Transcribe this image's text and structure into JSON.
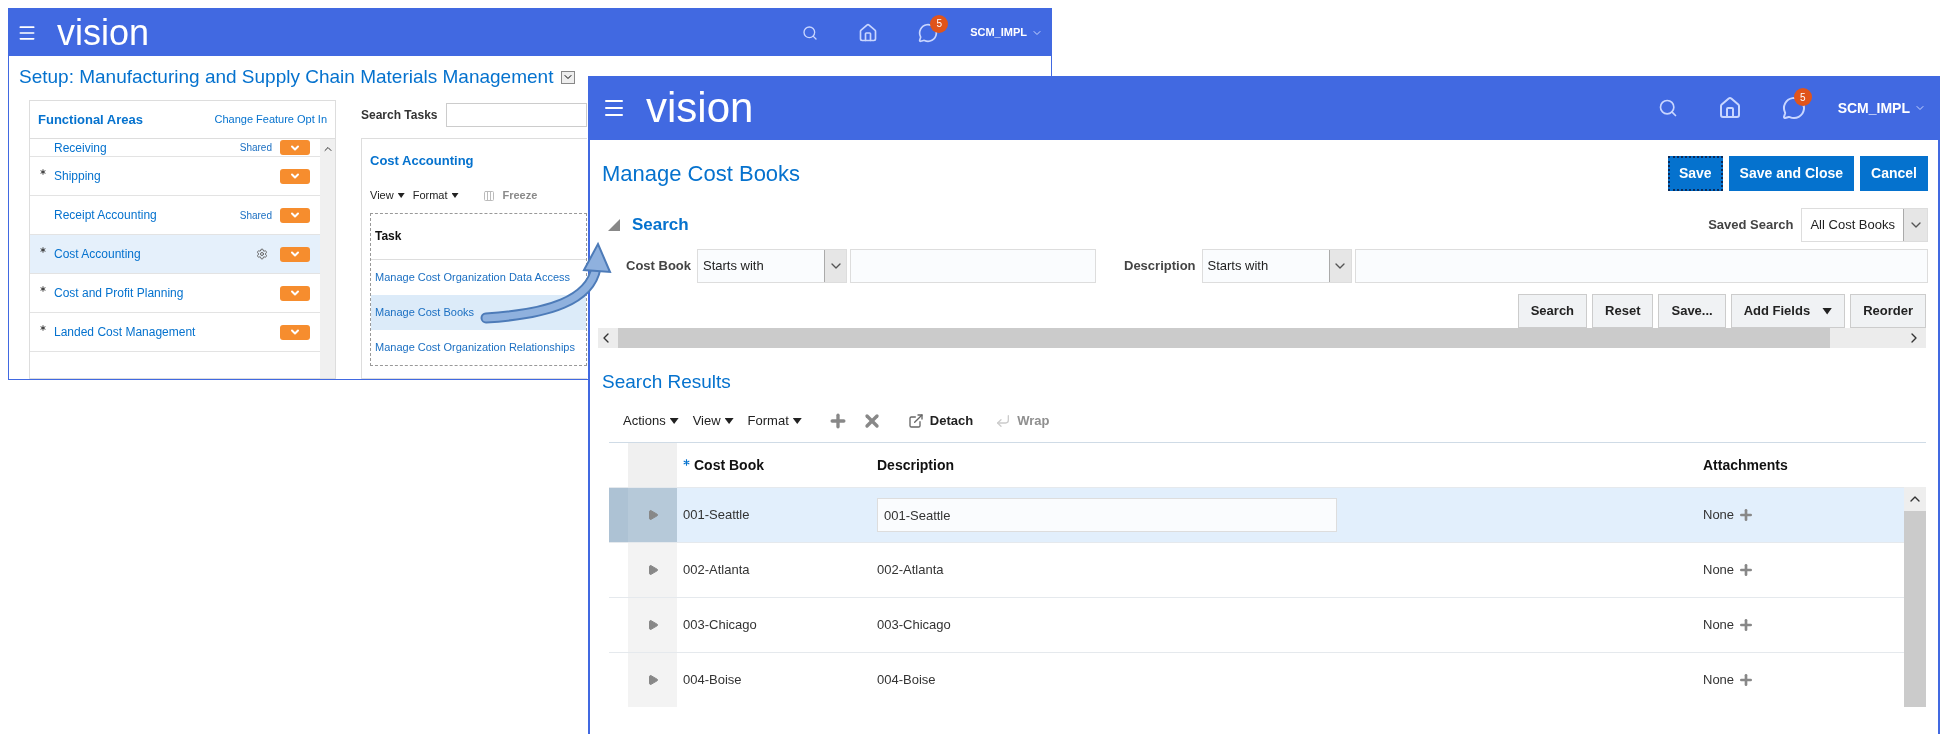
{
  "back_window": {
    "header": {
      "logo": "vision",
      "notification_count": "5",
      "user": "SCM_IMPL"
    },
    "title": "Setup: Manufacturing and Supply Chain Materials Management",
    "functional_areas": {
      "title": "Functional Areas",
      "link": "Change Feature Opt In",
      "items": [
        {
          "label": "Receiving",
          "required": false,
          "badge": "Shared",
          "configured": false,
          "selected": false
        },
        {
          "label": "Shipping",
          "required": true,
          "configured": false,
          "selected": false
        },
        {
          "label": "Receipt Accounting",
          "required": false,
          "badge": "Shared",
          "configured": false,
          "selected": false
        },
        {
          "label": "Cost Accounting",
          "required": true,
          "configured": true,
          "selected": true
        },
        {
          "label": "Cost and Profit Planning",
          "required": true,
          "configured": false,
          "selected": false
        },
        {
          "label": "Landed Cost Management",
          "required": true,
          "configured": false,
          "selected": false
        }
      ]
    },
    "search_tasks": {
      "label": "Search Tasks"
    },
    "tasks": {
      "title": "Cost Accounting",
      "menus": [
        "View",
        "Format"
      ],
      "freeze": {
        "label": "Freeze",
        "disabled": true
      },
      "column": "Task",
      "rows": [
        {
          "label": "Manage Cost Organization Data Access",
          "selected": false
        },
        {
          "label": "Manage Cost Books",
          "selected": true
        },
        {
          "label": "Manage Cost Organization Relationships",
          "selected": false
        }
      ]
    }
  },
  "front_window": {
    "header": {
      "logo": "vision",
      "notification_count": "5",
      "user": "SCM_IMPL"
    },
    "title": "Manage Cost Books",
    "actions": [
      {
        "label": "Save",
        "focused": true
      },
      {
        "label": "Save and Close",
        "focused": false
      },
      {
        "label": "Cancel",
        "focused": false
      }
    ],
    "search": {
      "title": "Search",
      "expanded": true,
      "saved_search": {
        "label": "Saved Search",
        "value": "All Cost Books"
      },
      "fields": [
        {
          "label": "Cost Book",
          "operator": "Starts with"
        },
        {
          "label": "Description",
          "operator": "Starts with"
        }
      ],
      "buttons": [
        {
          "label": "Search",
          "kind": "plain"
        },
        {
          "label": "Reset",
          "kind": "plain"
        },
        {
          "label": "Save...",
          "kind": "plain"
        },
        {
          "label": "Add Fields",
          "kind": "menu"
        },
        {
          "label": "Reorder",
          "kind": "plain"
        }
      ]
    },
    "results": {
      "title": "Search Results",
      "menus": [
        "Actions",
        "View",
        "Format"
      ],
      "detach": "Detach",
      "wrap": {
        "label": "Wrap",
        "disabled": true
      },
      "columns": [
        {
          "label": "Cost Book",
          "required": true
        },
        {
          "label": "Description",
          "required": false
        },
        {
          "label": "Attachments",
          "required": false
        }
      ],
      "rows": [
        {
          "cost_book": "001-Seattle",
          "description": "001-Seattle",
          "attachments": "None",
          "selected": true
        },
        {
          "cost_book": "002-Atlanta",
          "description": "002-Atlanta",
          "attachments": "None",
          "selected": false
        },
        {
          "cost_book": "003-Chicago",
          "description": "003-Chicago",
          "attachments": "None",
          "selected": false
        },
        {
          "cost_book": "004-Boise",
          "description": "004-Boise",
          "attachments": "None",
          "selected": false
        }
      ]
    }
  }
}
